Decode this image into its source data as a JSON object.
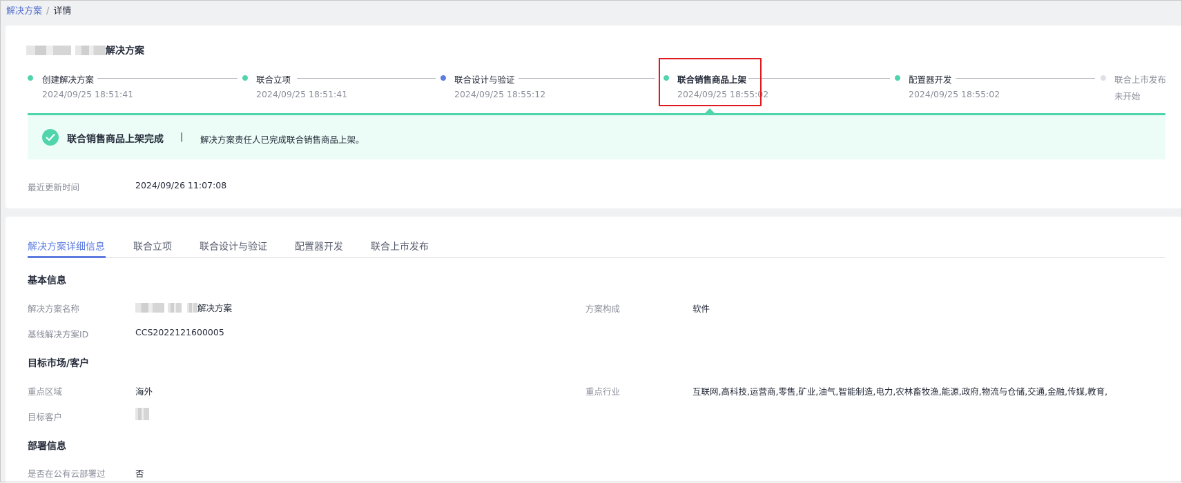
{
  "breadcrumb": {
    "parent": "解决方案",
    "separator": "/",
    "current": "详情"
  },
  "solution_title_suffix": "解决方案",
  "steps": [
    {
      "name": "创建解决方案",
      "time": "2024/09/25 18:51:41",
      "color": "#50d4ab"
    },
    {
      "name": "联合立项",
      "time": "2024/09/25 18:51:41",
      "color": "#50d4ab"
    },
    {
      "name": "联合设计与验证",
      "time": "2024/09/25 18:55:12",
      "color": "#5e7ce0"
    },
    {
      "name": "联合销售商品上架",
      "time": "2024/09/25 18:55:02",
      "color": "#50d4ab"
    },
    {
      "name": "配置器开发",
      "time": "2024/09/25 18:55:02",
      "color": "#50d4ab"
    },
    {
      "name": "联合上市发布",
      "time": "未开始",
      "color": "#dfe1e6"
    }
  ],
  "banner": {
    "title": "联合销售商品上架完成",
    "separator": "|",
    "description": "解决方案责任人已完成联合销售商品上架。"
  },
  "last_update": {
    "label": "最近更新时间",
    "value": "2024/09/26 11:07:08"
  },
  "tabs": [
    "解决方案详细信息",
    "联合立项",
    "联合设计与验证",
    "配置器开发",
    "联合上市发布"
  ],
  "basic_info": {
    "section": "基本信息",
    "name_label": "解决方案名称",
    "name_suffix": "解决方案",
    "composition_label": "方案构成",
    "composition_value": "软件",
    "baseline_label": "基线解决方案ID",
    "baseline_value": "CCS2022121600005"
  },
  "target_market": {
    "section": "目标市场/客户",
    "region_label": "重点区域",
    "region_value": "海外",
    "industry_label": "重点行业",
    "industry_value": "互联网,高科技,运营商,零售,矿业,油气,智能制造,电力,农林畜牧渔,能源,政府,物流与仓储,交通,金融,传媒,教育,房地...",
    "customer_label": "目标客户"
  },
  "deployment": {
    "section": "部署信息",
    "public_cloud_label": "是否在公有云部署过",
    "public_cloud_value": "否"
  }
}
